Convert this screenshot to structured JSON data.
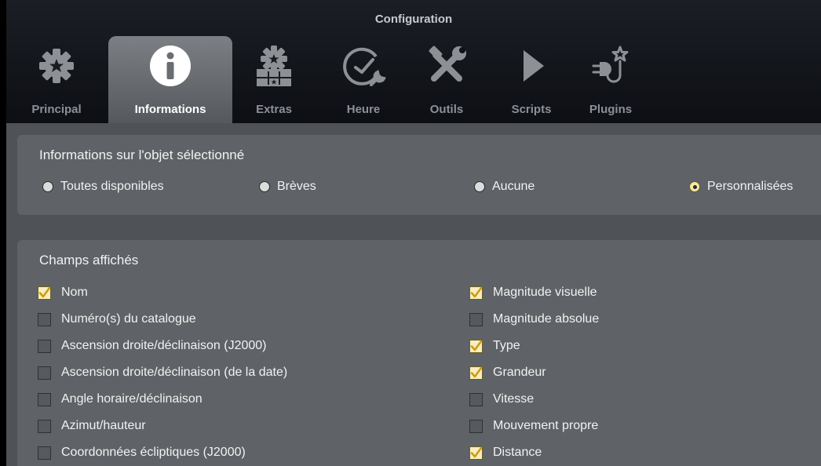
{
  "window": {
    "title": "Configuration"
  },
  "tabs": [
    {
      "label": "Principal",
      "icon": "gear-star-icon",
      "active": false
    },
    {
      "label": "Informations",
      "icon": "info-icon",
      "active": true
    },
    {
      "label": "Extras",
      "icon": "extras-gear-icon",
      "active": false
    },
    {
      "label": "Heure",
      "icon": "clock-icon",
      "active": false
    },
    {
      "label": "Outils",
      "icon": "tools-icon",
      "active": false
    },
    {
      "label": "Scripts",
      "icon": "play-icon",
      "active": false
    },
    {
      "label": "Plugins",
      "icon": "plug-star-icon",
      "active": false
    }
  ],
  "info_panel": {
    "title": "Informations sur l'objet sélectionné",
    "options": [
      {
        "label": "Toutes disponibles",
        "checked": false
      },
      {
        "label": "Brèves",
        "checked": false
      },
      {
        "label": "Aucune",
        "checked": false
      },
      {
        "label": "Personnalisées",
        "checked": true
      }
    ]
  },
  "fields_panel": {
    "title": "Champs affichés",
    "left": [
      {
        "label": "Nom",
        "checked": true
      },
      {
        "label": "Numéro(s) du catalogue",
        "checked": false
      },
      {
        "label": "Ascension droite/déclinaison (J2000)",
        "checked": false
      },
      {
        "label": "Ascension droite/déclinaison (de la date)",
        "checked": false
      },
      {
        "label": "Angle horaire/déclinaison",
        "checked": false
      },
      {
        "label": "Azimut/hauteur",
        "checked": false
      },
      {
        "label": "Coordonnées écliptiques (J2000)",
        "checked": false
      }
    ],
    "right": [
      {
        "label": "Magnitude visuelle",
        "checked": true
      },
      {
        "label": "Magnitude absolue",
        "checked": false
      },
      {
        "label": "Type",
        "checked": true
      },
      {
        "label": "Grandeur",
        "checked": true
      },
      {
        "label": "Vitesse",
        "checked": false
      },
      {
        "label": "Mouvement propre",
        "checked": false
      },
      {
        "label": "Distance",
        "checked": true
      }
    ]
  },
  "colors": {
    "active_tab": "#7c7f84",
    "checked_fill": "#f8eec0",
    "check_mark": "#d19a16",
    "panel": "#5f6266"
  }
}
